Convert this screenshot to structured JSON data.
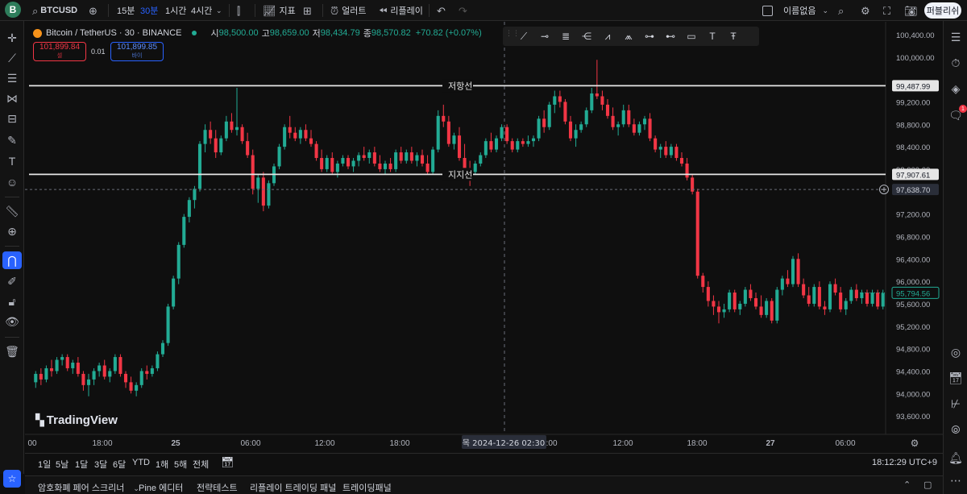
{
  "topbar": {
    "logo_letter": "B",
    "symbol": "BTCUSD",
    "intervals": [
      "15분",
      "30분",
      "1시간",
      "4시간"
    ],
    "active_interval": "30분",
    "indicators_label": "지표",
    "alert_label": "얼러트",
    "replay_label": "리플레이",
    "layout_name": "이름없음",
    "publish_label": "퍼블리쉬"
  },
  "legend": {
    "title": "Bitcoin / TetherUS · 30 · BINANCE",
    "open_k": "시",
    "open_v": "98,500.00",
    "high_k": "고",
    "high_v": "98,659.00",
    "low_k": "저",
    "low_v": "98,434.79",
    "close_k": "종",
    "close_v": "98,570.82",
    "change": "+70.82 (+0.07%)"
  },
  "trade": {
    "sell_price": "101,899.84",
    "sell_label": "셀",
    "spread": "0.01",
    "buy_price": "101,899.85",
    "buy_label": "바이"
  },
  "watermark": "TradingView",
  "crosshair_label": "목 2024-12-26   02:30",
  "current_price_label": "97,638.70",
  "utc_time": "18:12:29 UTC+9",
  "date_ranges": [
    "1일",
    "5날",
    "1달",
    "3달",
    "6달",
    "YTD",
    "1해",
    "5해",
    "전체"
  ],
  "bottom_panels": [
    "암호화폐 페어 스크리너",
    "Pine 에디터",
    "전략테스트",
    "리플레이 트레이딩 패널",
    "트레이딩패널"
  ],
  "colors": {
    "up": "#22ab94",
    "down": "#f23645",
    "accent": "#2962ff",
    "background": "#0f0f0f"
  },
  "chart_data": {
    "type": "candlestick",
    "symbol": "Bitcoin / TetherUS",
    "interval": "30",
    "exchange": "BINANCE",
    "ylim": [
      93300,
      100600
    ],
    "y_ticks": [
      "100,400.00",
      "100,000.00",
      "99,200.00",
      "98,800.00",
      "98,400.00",
      "98,000.00",
      "97,200.00",
      "96,800.00",
      "96,400.00",
      "96,000.00",
      "95,600.00",
      "95,200.00",
      "94,800.00",
      "94,400.00",
      "94,000.00",
      "93,600.00"
    ],
    "x_ticks": [
      "00",
      "18:00",
      "25",
      "06:00",
      "12:00",
      "18:00",
      "06:00",
      "12:00",
      "18:00",
      "27",
      "06:00"
    ],
    "horizontal_lines": [
      {
        "label": "저항선",
        "price": 99487.99,
        "price_label": "99,487.99"
      },
      {
        "label": "지지선",
        "price": 97907.61,
        "price_label": "97,907.61"
      }
    ],
    "current_price": 97638.7,
    "last_price": 95794.56,
    "last_price_label": "95,794.56",
    "candles": [
      [
        94200,
        94400,
        94100,
        94350
      ],
      [
        94350,
        94450,
        94150,
        94250
      ],
      [
        94250,
        94500,
        94200,
        94450
      ],
      [
        94450,
        94600,
        94300,
        94400
      ],
      [
        94400,
        94650,
        94350,
        94600
      ],
      [
        94600,
        94700,
        94500,
        94650
      ],
      [
        94650,
        94700,
        94400,
        94450
      ],
      [
        94450,
        94600,
        94350,
        94550
      ],
      [
        94550,
        94650,
        94300,
        94350
      ],
      [
        94350,
        94400,
        94050,
        94150
      ],
      [
        94150,
        94350,
        93950,
        94250
      ],
      [
        94250,
        94450,
        94150,
        94400
      ],
      [
        94400,
        94550,
        94300,
        94500
      ],
      [
        94500,
        94600,
        94250,
        94300
      ],
      [
        94300,
        94450,
        94200,
        94400
      ],
      [
        94400,
        94700,
        94350,
        94650
      ],
      [
        94650,
        94700,
        94300,
        94350
      ],
      [
        94350,
        94400,
        94100,
        94200
      ],
      [
        94200,
        94300,
        94000,
        94050
      ],
      [
        94050,
        94200,
        93950,
        94150
      ],
      [
        94150,
        94450,
        94100,
        94400
      ],
      [
        94400,
        94500,
        94250,
        94350
      ],
      [
        94350,
        94500,
        94300,
        94450
      ],
      [
        94450,
        94750,
        94400,
        94700
      ],
      [
        94700,
        94950,
        94650,
        94900
      ],
      [
        94900,
        95600,
        94850,
        95550
      ],
      [
        95550,
        96100,
        95500,
        96050
      ],
      [
        96050,
        96700,
        95950,
        96650
      ],
      [
        96650,
        97200,
        96600,
        97150
      ],
      [
        97150,
        97500,
        97050,
        97450
      ],
      [
        97450,
        97700,
        97300,
        97650
      ],
      [
        97650,
        98500,
        97600,
        98450
      ],
      [
        98450,
        98800,
        98300,
        98700
      ],
      [
        98700,
        98850,
        98450,
        98550
      ],
      [
        98550,
        98700,
        98200,
        98300
      ],
      [
        98300,
        98600,
        98250,
        98550
      ],
      [
        98550,
        98950,
        98500,
        98850
      ],
      [
        98850,
        99000,
        98650,
        98700
      ],
      [
        98700,
        99450,
        98600,
        98750
      ],
      [
        98750,
        98800,
        98450,
        98500
      ],
      [
        98500,
        98650,
        98200,
        98250
      ],
      [
        98250,
        98350,
        97550,
        97650
      ],
      [
        97650,
        97900,
        97400,
        97850
      ],
      [
        97850,
        97950,
        97250,
        97350
      ],
      [
        97350,
        97800,
        97300,
        97750
      ],
      [
        97750,
        98100,
        97700,
        98050
      ],
      [
        98050,
        98450,
        98000,
        98400
      ],
      [
        98400,
        98800,
        98350,
        98750
      ],
      [
        98750,
        98950,
        98550,
        98650
      ],
      [
        98650,
        98750,
        98500,
        98550
      ],
      [
        98550,
        98750,
        98450,
        98700
      ],
      [
        98700,
        98800,
        98500,
        98550
      ],
      [
        98550,
        98700,
        98400,
        98450
      ],
      [
        98450,
        98500,
        98150,
        98200
      ],
      [
        98200,
        98350,
        97950,
        98000
      ],
      [
        98000,
        98250,
        97950,
        98200
      ],
      [
        98200,
        98300,
        97900,
        97950
      ],
      [
        97950,
        98150,
        97850,
        98100
      ],
      [
        98100,
        98250,
        98050,
        98200
      ],
      [
        98200,
        98250,
        98000,
        98050
      ],
      [
        98050,
        98200,
        97950,
        98150
      ],
      [
        98150,
        98300,
        98050,
        98250
      ],
      [
        98250,
        98400,
        98150,
        98200
      ],
      [
        98200,
        98350,
        98100,
        98300
      ],
      [
        98300,
        98400,
        98050,
        98100
      ],
      [
        98100,
        98250,
        97950,
        98000
      ],
      [
        98000,
        98150,
        97900,
        98100
      ],
      [
        98100,
        98200,
        97950,
        98000
      ],
      [
        98000,
        98350,
        97950,
        98300
      ],
      [
        98300,
        98400,
        98100,
        98150
      ],
      [
        98150,
        98350,
        98100,
        98300
      ],
      [
        98300,
        98400,
        98100,
        98150
      ],
      [
        98150,
        98300,
        98050,
        98250
      ],
      [
        98250,
        98350,
        98050,
        98100
      ],
      [
        98100,
        98250,
        97900,
        97950
      ],
      [
        97950,
        98400,
        97900,
        98350
      ],
      [
        98350,
        99050,
        98300,
        98950
      ],
      [
        98950,
        99150,
        98750,
        98850
      ],
      [
        98850,
        98950,
        98400,
        98450
      ],
      [
        98450,
        98650,
        98350,
        98600
      ],
      [
        98600,
        98750,
        98150,
        98200
      ],
      [
        98200,
        98450,
        97900,
        98000
      ],
      [
        98000,
        98150,
        97700,
        97950
      ],
      [
        97950,
        98150,
        97900,
        98100
      ],
      [
        98100,
        98300,
        98050,
        98250
      ],
      [
        98250,
        98550,
        98200,
        98500
      ],
      [
        98500,
        98650,
        98300,
        98350
      ],
      [
        98350,
        98600,
        98300,
        98550
      ],
      [
        98550,
        98800,
        98500,
        98750
      ],
      [
        98750,
        98800,
        98450,
        98500
      ],
      [
        98500,
        98550,
        98300,
        98350
      ],
      [
        98350,
        98550,
        98300,
        98500
      ],
      [
        98500,
        98550,
        98400,
        98450
      ],
      [
        98450,
        98600,
        98400,
        98500
      ],
      [
        98500,
        98600,
        98400,
        98550
      ],
      [
        98550,
        98950,
        98500,
        98900
      ],
      [
        98900,
        99050,
        98650,
        98750
      ],
      [
        98750,
        99200,
        98700,
        99150
      ],
      [
        99150,
        99400,
        99000,
        99300
      ],
      [
        99300,
        99400,
        99100,
        99200
      ],
      [
        99200,
        99250,
        98800,
        98850
      ],
      [
        98850,
        98950,
        98500,
        98550
      ],
      [
        98550,
        98800,
        98400,
        98700
      ],
      [
        98700,
        98850,
        98650,
        98800
      ],
      [
        98800,
        99100,
        98750,
        99050
      ],
      [
        99050,
        99450,
        99000,
        99350
      ],
      [
        99350,
        99950,
        99250,
        99300
      ],
      [
        99300,
        99400,
        99050,
        99150
      ],
      [
        99150,
        99250,
        98900,
        98950
      ],
      [
        98950,
        99100,
        98700,
        98750
      ],
      [
        98750,
        98850,
        98600,
        98800
      ],
      [
        98800,
        99150,
        98750,
        99050
      ],
      [
        99050,
        99150,
        98750,
        98800
      ],
      [
        98800,
        98900,
        98600,
        98650
      ],
      [
        98650,
        98850,
        98600,
        98800
      ],
      [
        98800,
        98950,
        98700,
        98900
      ],
      [
        98900,
        99000,
        98500,
        98550
      ],
      [
        98550,
        98600,
        98300,
        98350
      ],
      [
        98350,
        98450,
        98200,
        98400
      ],
      [
        98400,
        98500,
        98200,
        98250
      ],
      [
        98250,
        98450,
        98200,
        98400
      ],
      [
        98400,
        98450,
        98150,
        98200
      ],
      [
        98200,
        98300,
        98050,
        98100
      ],
      [
        98100,
        98200,
        97800,
        97850
      ],
      [
        97850,
        97900,
        97550,
        97600
      ],
      [
        97600,
        97650,
        96050,
        96100
      ],
      [
        96100,
        96150,
        95800,
        95900
      ],
      [
        95900,
        96000,
        95550,
        95650
      ],
      [
        95650,
        95750,
        95400,
        95550
      ],
      [
        95550,
        95650,
        95250,
        95450
      ],
      [
        95450,
        95600,
        95350,
        95500
      ],
      [
        95500,
        95850,
        95450,
        95800
      ],
      [
        95800,
        95850,
        95450,
        95500
      ],
      [
        95500,
        95650,
        95400,
        95600
      ],
      [
        95600,
        95900,
        95550,
        95850
      ],
      [
        95850,
        95950,
        95650,
        95700
      ],
      [
        95700,
        95800,
        95500,
        95550
      ],
      [
        95550,
        95750,
        95350,
        95400
      ],
      [
        95400,
        95700,
        95350,
        95650
      ],
      [
        95650,
        95700,
        95250,
        95300
      ],
      [
        95300,
        95900,
        95250,
        95850
      ],
      [
        95850,
        96100,
        95750,
        96050
      ],
      [
        96050,
        96200,
        95900,
        95950
      ],
      [
        95950,
        96450,
        95900,
        96400
      ],
      [
        96400,
        96500,
        95900,
        95950
      ],
      [
        95950,
        96050,
        95700,
        95750
      ],
      [
        95750,
        95900,
        95550,
        95600
      ],
      [
        95600,
        95950,
        95550,
        95900
      ],
      [
        95900,
        96000,
        95500,
        95550
      ],
      [
        95550,
        95650,
        95400,
        95500
      ],
      [
        95500,
        96000,
        95450,
        95950
      ],
      [
        95950,
        96050,
        95750,
        95800
      ],
      [
        95800,
        95900,
        95450,
        95500
      ],
      [
        95500,
        95700,
        95400,
        95650
      ],
      [
        95650,
        95900,
        95600,
        95850
      ],
      [
        95850,
        95950,
        95650,
        95700
      ],
      [
        95700,
        95850,
        95600,
        95800
      ],
      [
        95800,
        95850,
        95550,
        95600
      ],
      [
        95600,
        95850,
        95550,
        95800
      ],
      [
        95800,
        95850,
        95500,
        95550
      ],
      [
        95550,
        95850,
        95500,
        95790
      ]
    ]
  }
}
